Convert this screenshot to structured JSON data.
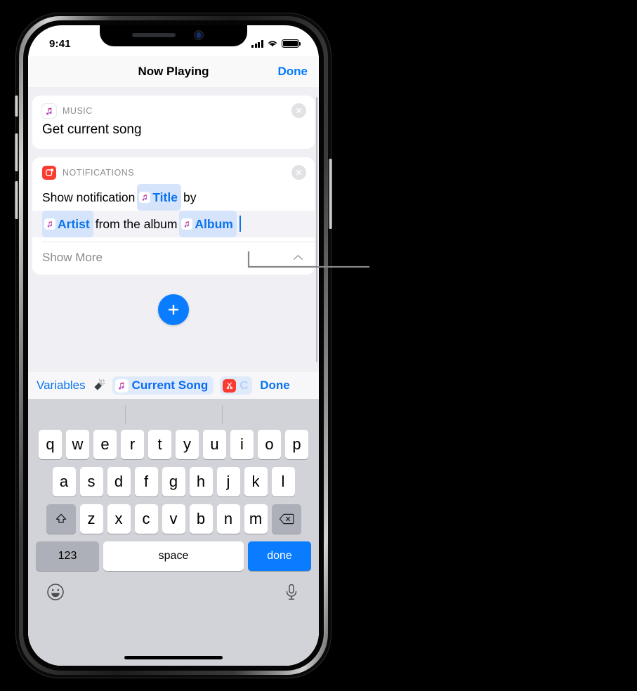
{
  "status_bar": {
    "time": "9:41",
    "signal_icon": "cellular-bars-icon",
    "wifi_icon": "wifi-icon",
    "battery_icon": "battery-full-icon"
  },
  "nav_bar": {
    "title": "Now Playing",
    "done_label": "Done"
  },
  "actions": [
    {
      "category": "MUSIC",
      "icon": "music-app-icon",
      "title": "Get current song",
      "remove_icon": "close-circle-icon"
    },
    {
      "category": "NOTIFICATIONS",
      "icon": "notifications-app-icon",
      "remove_icon": "close-circle-icon",
      "line1_prefix": "Show notification",
      "token_title": "Title",
      "line1_suffix": "by",
      "token_artist": "Artist",
      "line2_middle": "from the album",
      "token_album": "Album",
      "show_more_label": "Show More",
      "show_more_chevron": "chevron-up-icon"
    }
  ],
  "add_action": {
    "icon": "plus-icon",
    "label": "Add action"
  },
  "variables_bar": {
    "variables_label": "Variables",
    "magic_wand_icon": "magic-wand-icon",
    "token_current_song": "Current Song",
    "token_current_song_icon": "music-note-icon",
    "token_clipboard_partial": "C",
    "token_clipboard_icon": "scissors-icon",
    "done_label": "Done"
  },
  "keyboard": {
    "row1": [
      "q",
      "w",
      "e",
      "r",
      "t",
      "y",
      "u",
      "i",
      "o",
      "p"
    ],
    "row2": [
      "a",
      "s",
      "d",
      "f",
      "g",
      "h",
      "j",
      "k",
      "l"
    ],
    "row3": [
      "z",
      "x",
      "c",
      "v",
      "b",
      "n",
      "m"
    ],
    "shift_icon": "shift-arrow-icon",
    "backspace_icon": "backspace-icon",
    "numbers_label": "123",
    "space_label": "space",
    "done_label": "done",
    "emoji_icon": "emoji-smiley-icon",
    "dictation_icon": "microphone-icon"
  },
  "colors": {
    "accent_blue": "#0a7cff",
    "link_blue": "#007aff",
    "token_blue_bg": "#d6e4fb",
    "notifications_red": "#fc3b30",
    "card_white": "#ffffff",
    "page_gray": "#efeff4",
    "keyboard_gray": "#d1d3d9"
  }
}
